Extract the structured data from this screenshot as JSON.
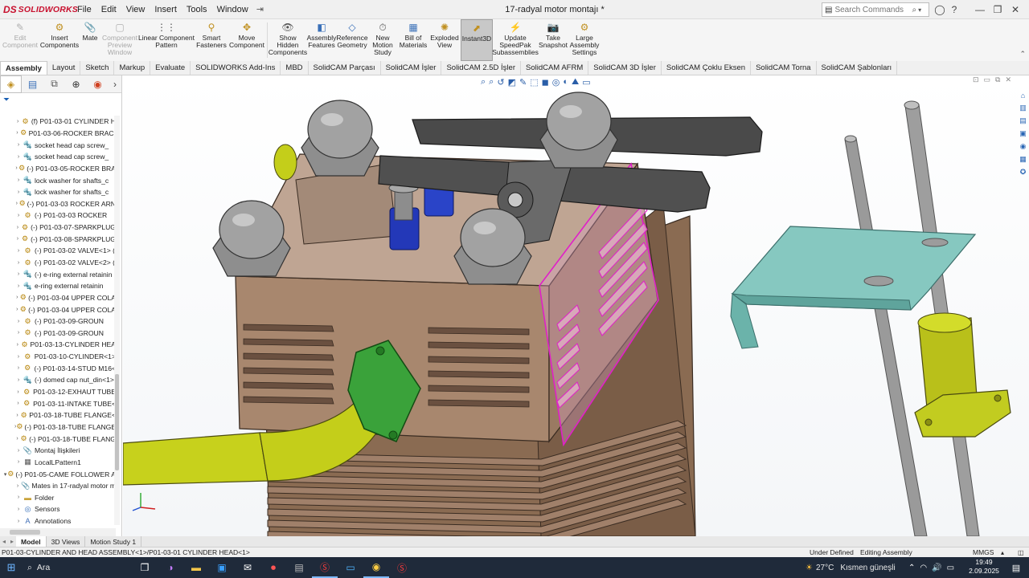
{
  "app": {
    "logo_ds": "DS",
    "logo_text": "SOLIDWORKS",
    "document_title": "17-radyal motor montajı *",
    "menu": [
      "File",
      "Edit",
      "View",
      "Insert",
      "Tools",
      "Window"
    ],
    "search_placeholder": "Search Commands"
  },
  "command_manager": [
    {
      "label": "Edit\nComponent",
      "disabled": true,
      "icon": "edit-component-icon"
    },
    {
      "label": "Insert\nComponents",
      "disabled": false,
      "icon": "insert-components-icon"
    },
    {
      "label": "Mate",
      "disabled": false,
      "icon": "mate-icon"
    },
    {
      "label": "Component\nPreview\nWindow",
      "disabled": true,
      "icon": "component-preview-icon"
    },
    {
      "label": "Linear Component\nPattern",
      "disabled": false,
      "icon": "linear-pattern-icon"
    },
    {
      "label": "Smart\nFasteners",
      "disabled": false,
      "icon": "smart-fasteners-icon"
    },
    {
      "label": "Move\nComponent",
      "disabled": false,
      "icon": "move-component-icon"
    },
    {
      "label": "Show\nHidden\nComponents",
      "disabled": false,
      "icon": "show-hidden-icon"
    },
    {
      "label": "Assembly\nFeatures",
      "disabled": false,
      "icon": "assembly-features-icon"
    },
    {
      "label": "Reference\nGeometry",
      "disabled": false,
      "icon": "reference-geometry-icon"
    },
    {
      "label": "New\nMotion\nStudy",
      "disabled": false,
      "icon": "motion-study-icon"
    },
    {
      "label": "Bill of\nMaterials",
      "disabled": false,
      "icon": "bom-icon"
    },
    {
      "label": "Exploded\nView",
      "disabled": false,
      "icon": "exploded-view-icon"
    },
    {
      "label": "Instant3D",
      "disabled": false,
      "active": true,
      "icon": "instant3d-icon"
    },
    {
      "label": "Update\nSpeedPak\nSubassemblies",
      "disabled": false,
      "icon": "speedpak-icon"
    },
    {
      "label": "Take\nSnapshot",
      "disabled": false,
      "icon": "snapshot-icon"
    },
    {
      "label": "Large\nAssembly\nSettings",
      "disabled": false,
      "icon": "large-assembly-icon"
    }
  ],
  "tabs": [
    "Assembly",
    "Layout",
    "Sketch",
    "Markup",
    "Evaluate",
    "SOLIDWORKS Add-Ins",
    "MBD",
    "SolidCAM Parçası",
    "SolidCAM İşler",
    "SolidCAM 2.5D İşler",
    "SolidCAM AFRM",
    "SolidCAM 3D İşler",
    "SolidCAM Çoklu Eksen",
    "SolidCAM Torna",
    "SolidCAM Şablonları"
  ],
  "tree": [
    {
      "label": "(f) P01-03-01 CYLINDER H",
      "icon": "part",
      "level": 1
    },
    {
      "label": "P01-03-06-ROCKER BRACI",
      "icon": "part",
      "level": 1
    },
    {
      "label": "socket head cap screw_",
      "icon": "screw",
      "level": 1
    },
    {
      "label": "socket head cap screw_",
      "icon": "screw",
      "level": 1
    },
    {
      "label": "(-) P01-03-05-ROCKER BRA",
      "icon": "part",
      "level": 1
    },
    {
      "label": "lock washer for shafts_c",
      "icon": "screw",
      "level": 1
    },
    {
      "label": "lock washer for shafts_c",
      "icon": "screw",
      "level": 1
    },
    {
      "label": "(-) P01-03-03 ROCKER ARN",
      "icon": "part",
      "level": 1
    },
    {
      "label": "(-) P01-03-03 ROCKER",
      "icon": "asm",
      "level": 1
    },
    {
      "label": "(-) P01-03-07-SPARKPLUG",
      "icon": "part",
      "level": 1
    },
    {
      "label": "(-) P01-03-08-SPARKPLUG",
      "icon": "part",
      "level": 1
    },
    {
      "label": "(-) P01-03-02 VALVE<1> (",
      "icon": "part",
      "level": 1
    },
    {
      "label": "(-) P01-03-02 VALVE<2> (",
      "icon": "part",
      "level": 1
    },
    {
      "label": "(-) e-ring external retainin",
      "icon": "screw",
      "level": 1
    },
    {
      "label": "e-ring external retainin",
      "icon": "screw",
      "level": 1
    },
    {
      "label": "(-) P01-03-04 UPPER COLA",
      "icon": "part",
      "level": 1
    },
    {
      "label": "(-) P01-03-04 UPPER COLA",
      "icon": "part",
      "level": 1
    },
    {
      "label": "(-) P01-03-09-GROUN",
      "icon": "asm",
      "level": 1
    },
    {
      "label": "(-) P01-03-09-GROUN",
      "icon": "asm",
      "level": 1
    },
    {
      "label": "P01-03-13-CYLINDER HEA",
      "icon": "part",
      "level": 1
    },
    {
      "label": "P01-03-10-CYLINDER<1>",
      "icon": "part",
      "level": 1
    },
    {
      "label": "(-) P01-03-14-STUD M16<",
      "icon": "part",
      "level": 1
    },
    {
      "label": "(-) domed cap nut_din<1>",
      "icon": "screw",
      "level": 1
    },
    {
      "label": "P01-03-12-EXHAUT TUBE",
      "icon": "part",
      "level": 1
    },
    {
      "label": "P01-03-11-INTAKE TUBE<",
      "icon": "part",
      "level": 1
    },
    {
      "label": "P01-03-18-TUBE FLANGE<",
      "icon": "part",
      "level": 1
    },
    {
      "label": "(-) P01-03-18-TUBE FLANGE",
      "icon": "part",
      "level": 1
    },
    {
      "label": "(-) P01-03-18-TUBE FLANG",
      "icon": "part",
      "level": 1
    },
    {
      "label": "Montaj İlişkileri",
      "icon": "mate",
      "level": 1
    },
    {
      "label": "LocalLPattern1",
      "icon": "pattern",
      "level": 1
    },
    {
      "label": "(-) P01-05-CAME FOLLOWER A",
      "icon": "asm",
      "level": 0
    },
    {
      "label": "Mates in 17-radyal motor m",
      "icon": "mate",
      "level": 1
    },
    {
      "label": "Folder",
      "icon": "folder",
      "level": 1
    },
    {
      "label": "Sensors",
      "icon": "sensor",
      "level": 1
    },
    {
      "label": "Annotations",
      "icon": "note",
      "level": 1
    }
  ],
  "bottom_tabs": [
    "Model",
    "3D Views",
    "Motion Study 1"
  ],
  "status": {
    "path": "P01-03-CYLINDER AND HEAD ASSEMBLY<1>/P01-03-01 CYLINDER HEAD<1>",
    "state": "Under Defined",
    "mode": "Editing Assembly",
    "units": "MMGS"
  },
  "taskbar": {
    "search_text": "Ara",
    "weather_temp": "27°C",
    "weather_text": "Kısmen güneşli",
    "time": "19:49",
    "date": "2.09.2025"
  },
  "colors": {
    "cylinder": "#8c6a52",
    "cylinder_light": "#a4846c",
    "head_top": "#b49a86",
    "nut": "#9a9a9a",
    "rocker": "#4a4a4a",
    "yellow_tube": "#c7d11c",
    "green_flange": "#3aa23a",
    "teal_bracket": "#7fc3bb",
    "rod": "#8e8e8e",
    "selection": "#e020c8",
    "spring": "#1f3fbf"
  }
}
